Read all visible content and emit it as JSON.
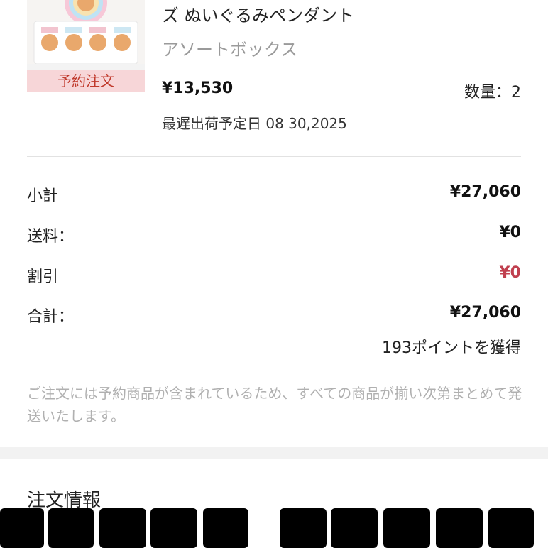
{
  "product": {
    "name": "ズ ぬいぐるみペンダント",
    "variant": "アソートボックス",
    "preorder_tag": "予約注文",
    "price": "¥13,530",
    "quantity_label": "数量：",
    "quantity": "2",
    "ship_date_label": "最遅出荷予定日",
    "ship_date": "08 30,2025"
  },
  "summary": {
    "subtotal_label": "小計",
    "subtotal": "¥27,060",
    "shipping_label": "送料：",
    "shipping": "¥0",
    "discount_label": "割引",
    "discount": "¥0",
    "total_label": "合計：",
    "total": "¥27,060",
    "points": "193ポイントを獲得"
  },
  "note": "ご注文には予約商品が含まれているため、すべての商品が揃い次第まとめて発送いたします。",
  "order_info": {
    "title": "注文情報"
  },
  "colors": {
    "discount": "#c0404f",
    "preorder_bg": "#f7d6d8",
    "preorder_text": "#c0392b",
    "note_text": "#b0b0b0"
  }
}
